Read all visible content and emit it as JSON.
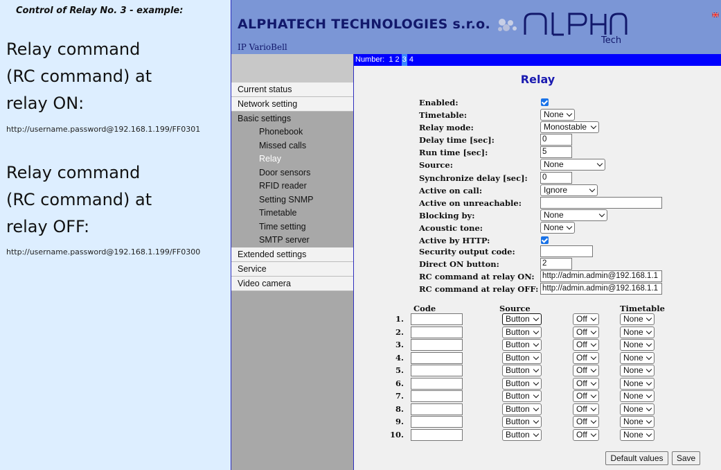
{
  "annotation": {
    "heading": "Control of Relay No. 3 - example:",
    "on_lines": [
      "Relay command",
      "(RC command) at",
      "relay ON:"
    ],
    "on_url": "http://username.password@192.168.1.199/FF0301",
    "off_lines": [
      "Relay command",
      "(RC command) at",
      "relay OFF:"
    ],
    "off_url": "http://username.password@192.168.1.199/FF0300"
  },
  "header": {
    "company": "ALPHATECH TECHNOLOGIES s.r.o.",
    "product": "IP VarioBell",
    "logo_text": "ALPHA",
    "logo_sub": "Tech",
    "brand_color": "#12186b",
    "header_color": "#7b96d6"
  },
  "sidebar": {
    "top_items": [
      "Current status",
      "Network setting"
    ],
    "basic_label": "Basic settings",
    "sub_items": [
      "Phonebook",
      "Missed calls",
      "Relay",
      "Door sensors",
      "RFID reader",
      "Setting SNMP",
      "Timetable",
      "Time setting",
      "SMTP server"
    ],
    "active_sub": "Relay",
    "bottom_items": [
      "Extended settings",
      "Service",
      "Video camera"
    ]
  },
  "numbar": {
    "label": "Number:",
    "numbers": [
      "1",
      "2",
      "3",
      "4"
    ],
    "selected": "3"
  },
  "page_title": "Relay",
  "fields": [
    {
      "label": "Enabled:",
      "type": "checkbox",
      "checked": true
    },
    {
      "label": "Timetable:",
      "type": "select",
      "value": "None"
    },
    {
      "label": "Relay mode:",
      "type": "select",
      "value": "Monostable"
    },
    {
      "label": "Delay time [sec]:",
      "type": "text",
      "value": "0"
    },
    {
      "label": "Run time [sec]:",
      "type": "text",
      "value": "5"
    },
    {
      "label": "Source:",
      "type": "select",
      "value": "None"
    },
    {
      "label": "Synchronize delay [sec]:",
      "type": "text",
      "value": "0"
    },
    {
      "label": "Active on call:",
      "type": "select",
      "value": "Ignore"
    },
    {
      "label": "Active on unreachable:",
      "type": "text",
      "value": ""
    },
    {
      "label": "Blocking by:",
      "type": "select",
      "value": "None"
    },
    {
      "label": "Acoustic tone:",
      "type": "select",
      "value": "None"
    },
    {
      "label": "Active by HTTP:",
      "type": "checkbox",
      "checked": true
    },
    {
      "label": "Security output code:",
      "type": "text",
      "value": ""
    },
    {
      "label": "Direct ON button:",
      "type": "text",
      "value": "2"
    },
    {
      "label": "RC command at relay ON:",
      "type": "text",
      "value": "http://admin.admin@192.168.1.1"
    },
    {
      "label": "RC command at relay OFF:",
      "type": "text",
      "value": "http://admin.admin@192.168.1.1"
    }
  ],
  "code_table": {
    "headers": {
      "code": "Code",
      "source": "Source",
      "timetable": "Timetable"
    },
    "rows": [
      {
        "num": "1.",
        "code": "",
        "source": "Button",
        "state": "Off",
        "timetable": "None"
      },
      {
        "num": "2.",
        "code": "",
        "source": "Button",
        "state": "Off",
        "timetable": "None"
      },
      {
        "num": "3.",
        "code": "",
        "source": "Button",
        "state": "Off",
        "timetable": "None"
      },
      {
        "num": "4.",
        "code": "",
        "source": "Button",
        "state": "Off",
        "timetable": "None"
      },
      {
        "num": "5.",
        "code": "",
        "source": "Button",
        "state": "Off",
        "timetable": "None"
      },
      {
        "num": "6.",
        "code": "",
        "source": "Button",
        "state": "Off",
        "timetable": "None"
      },
      {
        "num": "7.",
        "code": "",
        "source": "Button",
        "state": "Off",
        "timetable": "None"
      },
      {
        "num": "8.",
        "code": "",
        "source": "Button",
        "state": "Off",
        "timetable": "None"
      },
      {
        "num": "9.",
        "code": "",
        "source": "Button",
        "state": "Off",
        "timetable": "None"
      },
      {
        "num": "10.",
        "code": "",
        "source": "Button",
        "state": "Off",
        "timetable": "None"
      }
    ]
  },
  "buttons": {
    "default": "Default values",
    "save": "Save"
  }
}
